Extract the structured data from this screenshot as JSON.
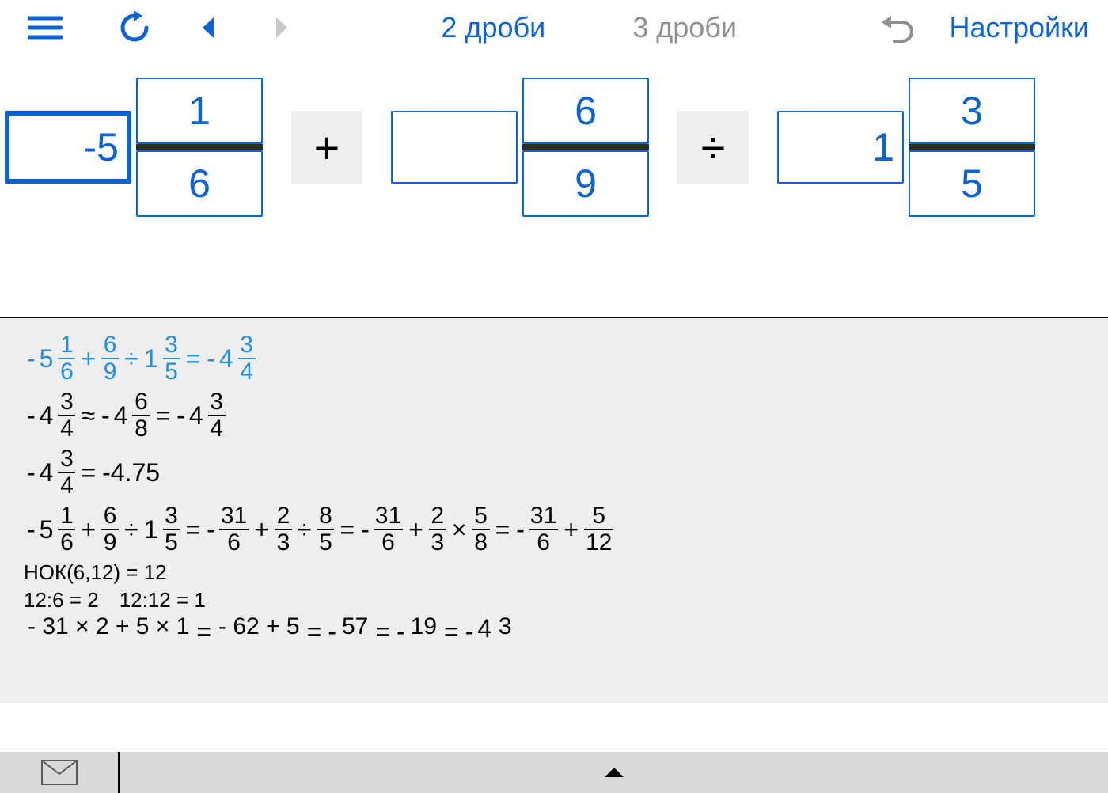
{
  "toolbar": {
    "tab_2": "2 дроби",
    "tab_3": "3 дроби",
    "settings": "Настройки"
  },
  "editor": {
    "terms": [
      {
        "whole": "-5",
        "num": "1",
        "den": "6",
        "selected": true
      },
      {
        "whole": "",
        "num": "6",
        "den": "9",
        "selected": false
      },
      {
        "whole": "1",
        "num": "3",
        "den": "5",
        "selected": false
      }
    ],
    "ops": [
      "+",
      "÷"
    ]
  },
  "solution": {
    "line1": {
      "a": {
        "whole": "5",
        "n": "1",
        "d": "6"
      },
      "b": {
        "n": "6",
        "d": "9"
      },
      "c": {
        "whole": "1",
        "n": "3",
        "d": "5"
      },
      "op1": "+",
      "op2": "÷",
      "eq": "=",
      "r": {
        "whole": "4",
        "n": "3",
        "d": "4"
      }
    },
    "line2": {
      "a": {
        "whole": "4",
        "n": "3",
        "d": "4"
      },
      "approx": "≈",
      "b": {
        "whole": "4",
        "n": "6",
        "d": "8"
      },
      "eq": "=",
      "c": {
        "whole": "4",
        "n": "3",
        "d": "4"
      }
    },
    "line3": {
      "a": {
        "whole": "4",
        "n": "3",
        "d": "4"
      },
      "eq": "=",
      "dec": "-4.75"
    },
    "line4": {
      "lhs_a": {
        "whole": "5",
        "n": "1",
        "d": "6"
      },
      "lhs_b": {
        "n": "6",
        "d": "9"
      },
      "lhs_c": {
        "whole": "1",
        "n": "3",
        "d": "5"
      },
      "s1_a": {
        "n": "31",
        "d": "6"
      },
      "s1_b": {
        "n": "2",
        "d": "3"
      },
      "s1_c": {
        "n": "8",
        "d": "5"
      },
      "s2_a": {
        "n": "31",
        "d": "6"
      },
      "s2_b": {
        "n": "2",
        "d": "3"
      },
      "s2_c": {
        "n": "5",
        "d": "8"
      },
      "s3_a": {
        "n": "31",
        "d": "6"
      },
      "s3_b": {
        "n": "5",
        "d": "12"
      },
      "plus": "+",
      "div": "÷",
      "mul": "×",
      "eq": "="
    },
    "note1": "НОК(6,12) = 12",
    "note2a": "12:6 = 2",
    "note2b": "12:12 = 1",
    "line5": {
      "a_n": "- 31 × 2 + 5 × 1",
      "b_n": "- 62 + 5",
      "c_n": "57",
      "d_n": "19",
      "e_whole": "4",
      "e_n": "3",
      "eq": "="
    }
  }
}
